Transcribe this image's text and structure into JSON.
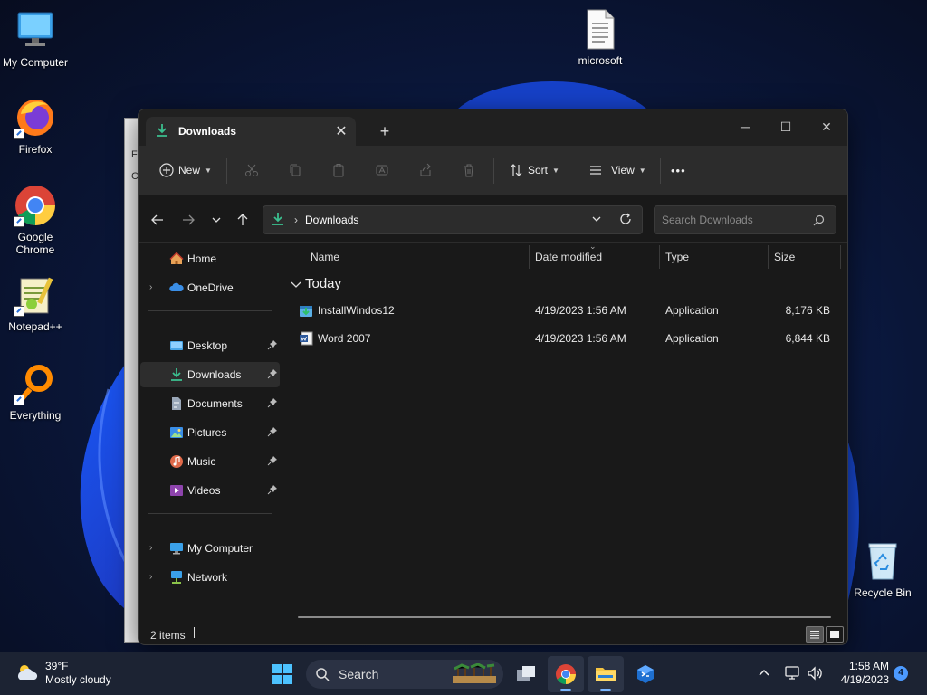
{
  "desktop": {
    "icons": [
      {
        "label": "My Computer",
        "icon": "monitor-icon"
      },
      {
        "label": "Firefox",
        "icon": "firefox-icon"
      },
      {
        "label": "Google Chrome",
        "icon": "chrome-icon"
      },
      {
        "label": "Notepad++",
        "icon": "notepadpp-icon"
      },
      {
        "label": "Everything",
        "icon": "everything-icon"
      },
      {
        "label": "microsoft",
        "icon": "text-file-icon"
      },
      {
        "label": "Recycle Bin",
        "icon": "recycle-bin-icon"
      }
    ],
    "back_window_letters": [
      "F",
      "C"
    ]
  },
  "explorer": {
    "tab_title": "Downloads",
    "toolbar": {
      "new_label": "New",
      "sort_label": "Sort",
      "view_label": "View",
      "more_label": "•••"
    },
    "address": {
      "separator": "›",
      "path": "Downloads"
    },
    "search": {
      "placeholder": "Search Downloads"
    },
    "nav": {
      "home": "Home",
      "onedrive": "OneDrive",
      "desktop": "Desktop",
      "downloads": "Downloads",
      "documents": "Documents",
      "pictures": "Pictures",
      "music": "Music",
      "videos": "Videos",
      "my_computer": "My Computer",
      "network": "Network"
    },
    "columns": {
      "name": "Name",
      "date": "Date modified",
      "type": "Type",
      "size": "Size"
    },
    "group_label": "Today",
    "files": [
      {
        "name": "InstallWindos12",
        "date": "4/19/2023 1:56 AM",
        "type": "Application",
        "size": "8,176 KB",
        "icon": "installer-icon"
      },
      {
        "name": "Word 2007",
        "date": "4/19/2023 1:56 AM",
        "type": "Application",
        "size": "6,844 KB",
        "icon": "word-icon"
      }
    ],
    "status": {
      "item_count": "2 items"
    }
  },
  "taskbar": {
    "weather": {
      "temp": "39°F",
      "condition": "Mostly cloudy"
    },
    "search_label": "Search",
    "clock": {
      "time": "1:58 AM",
      "date": "4/19/2023"
    },
    "notification_count": "4"
  }
}
